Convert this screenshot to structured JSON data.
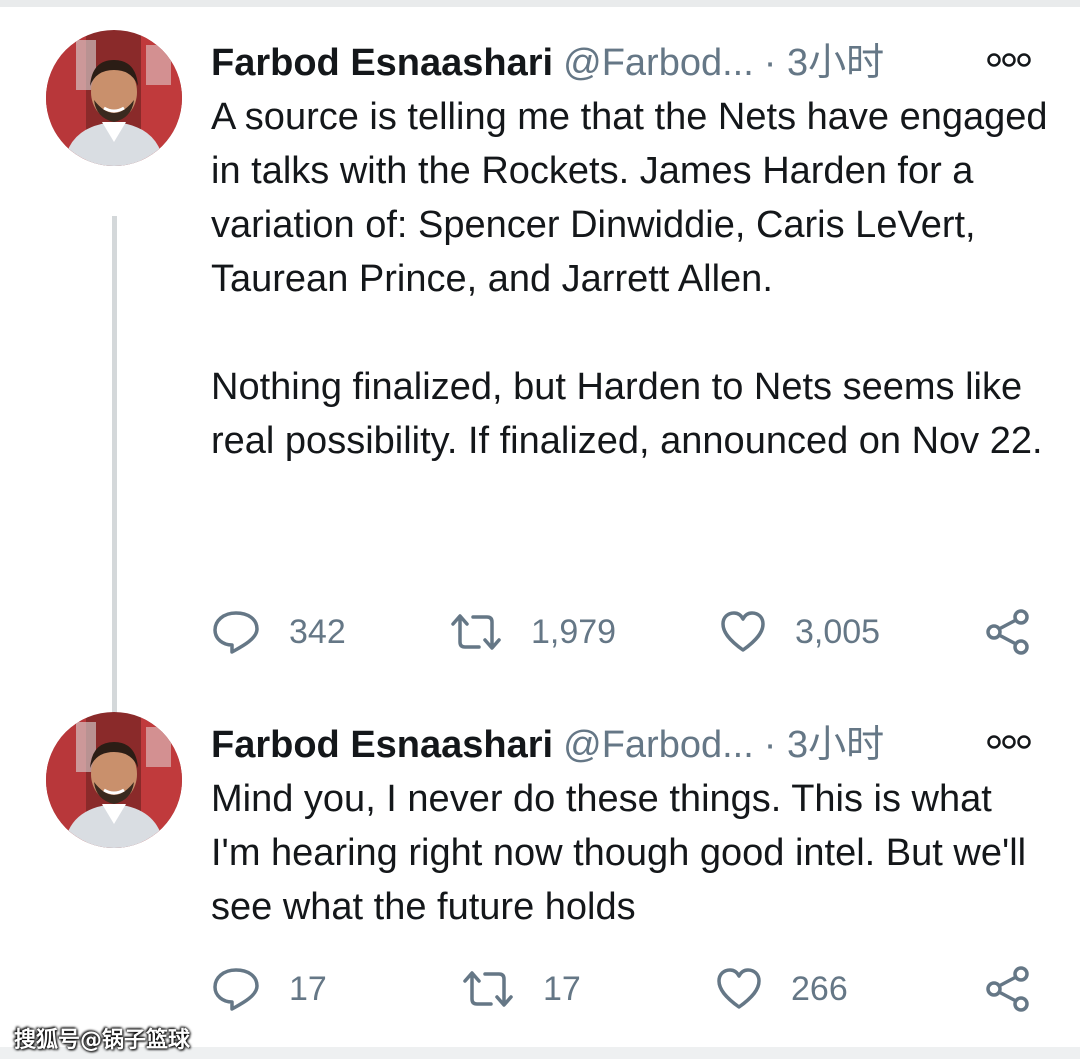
{
  "tweets": [
    {
      "author": {
        "name": "Farbod Esnaashari",
        "handle": "@Farbod...",
        "avatar_icon": "profile-photo"
      },
      "time_sep": "·",
      "time": "3小时",
      "more_icon": "more-options-icon",
      "body": [
        "A source is telling me that the Nets have engaged in talks with the Rockets. James Harden for a variation of: Spencer Dinwiddie, Caris LeVert, Taurean Prince, and Jarrett Allen.",
        "Nothing finalized, but Harden to Nets seems like real possibility. If finalized, announced on Nov 22."
      ],
      "stats": {
        "replies": "342",
        "retweets": "1,979",
        "likes": "3,005"
      }
    },
    {
      "author": {
        "name": "Farbod Esnaashari",
        "handle": "@Farbod...",
        "avatar_icon": "profile-photo"
      },
      "time_sep": "·",
      "time": "3小时",
      "more_icon": "more-options-icon",
      "body": [
        "Mind you, I never do these things. This is what I'm hearing right now though good intel. But we'll see what the future holds"
      ],
      "stats": {
        "replies": "17",
        "retweets": "17",
        "likes": "266"
      }
    }
  ],
  "watermark": "搜狐号@锅子篮球",
  "colors": {
    "text": "#14171a",
    "secondary": "#657786",
    "thread_line": "#d4d8da",
    "background": "#ffffff"
  }
}
